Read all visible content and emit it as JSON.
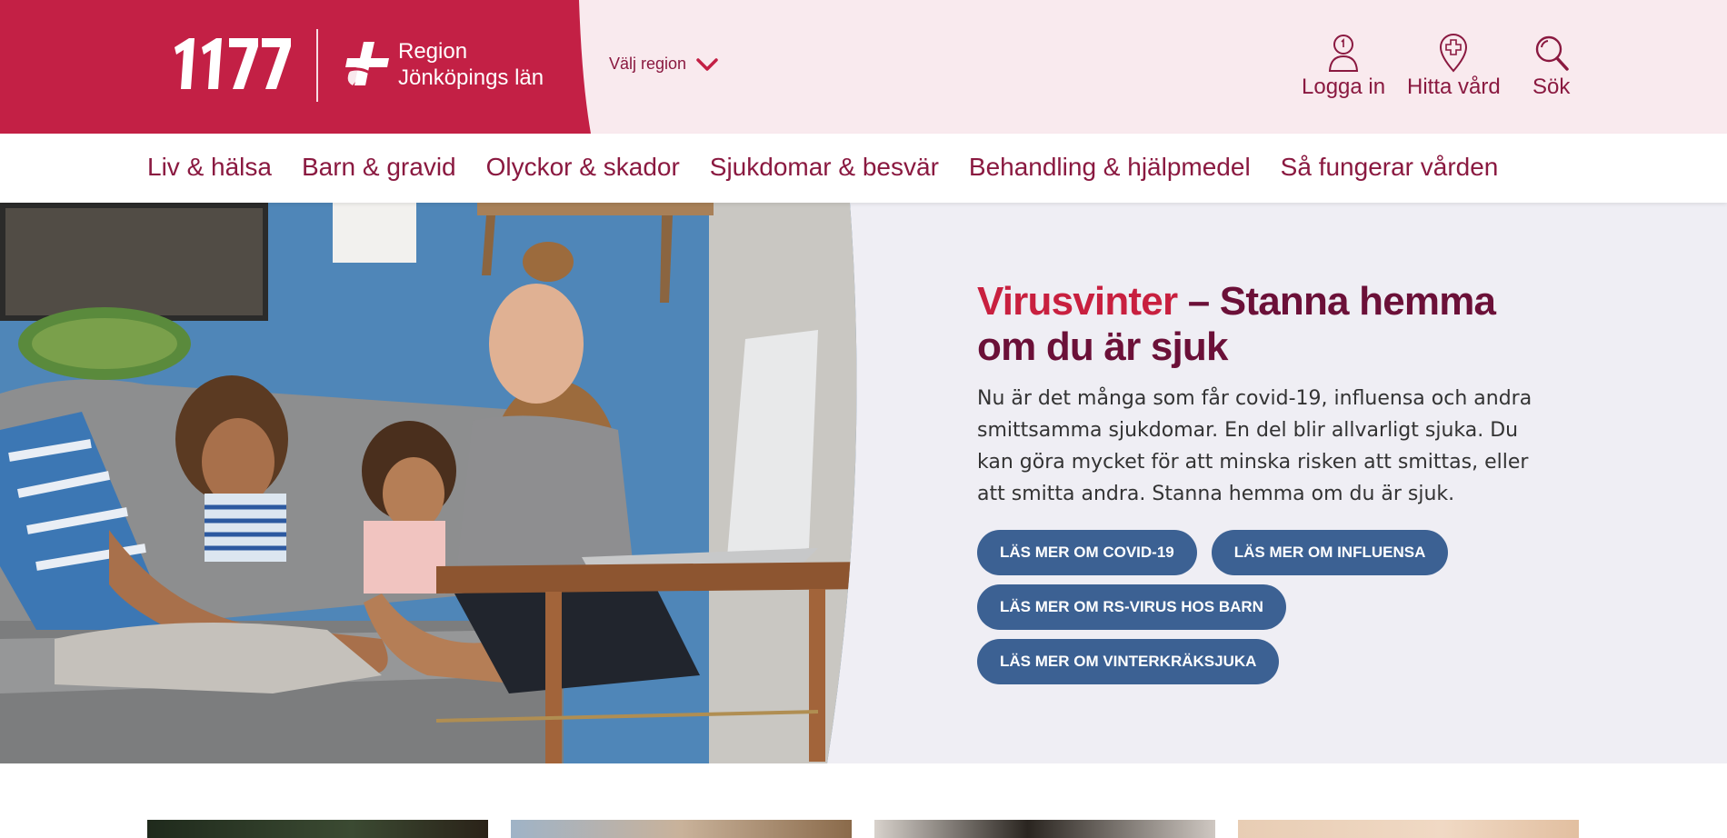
{
  "header": {
    "logo_text": "1177",
    "region_line1": "Region",
    "region_line2": "Jönköpings län",
    "region_select_label": "Välj region",
    "login_label": "Logga in",
    "find_care_label": "Hitta vård",
    "search_label": "Sök",
    "colors": {
      "brand": "#c32045",
      "accent": "#8a1940",
      "header_bg": "#f9eaee"
    }
  },
  "nav": {
    "items": [
      {
        "label": "Liv & hälsa"
      },
      {
        "label": "Barn & gravid"
      },
      {
        "label": "Olyckor & skador"
      },
      {
        "label": "Sjukdomar & besvär"
      },
      {
        "label": "Behandling & hjälpmedel"
      },
      {
        "label": "Så fungerar vården"
      }
    ]
  },
  "hero": {
    "title_accent": "Virusvinter",
    "title_rest": " – Stanna hemma om du är sjuk",
    "text": "Nu är det många som får covid-19, influensa och andra smittsamma sjukdomar. En del blir allvarligt sjuka. Du kan göra mycket för att minska risken att smittas, eller att smitta andra. Stanna hemma om du är sjuk.",
    "buttons": [
      {
        "label": "LÄS MER OM COVID-19"
      },
      {
        "label": "LÄS MER OM INFLUENSA"
      },
      {
        "label": "LÄS MER OM RS-VIRUS HOS BARN"
      },
      {
        "label": "LÄS MER OM VINTERKRÄKSJUKA"
      }
    ],
    "button_color": "#3c6193",
    "image": "family-on-sofa-photo"
  }
}
